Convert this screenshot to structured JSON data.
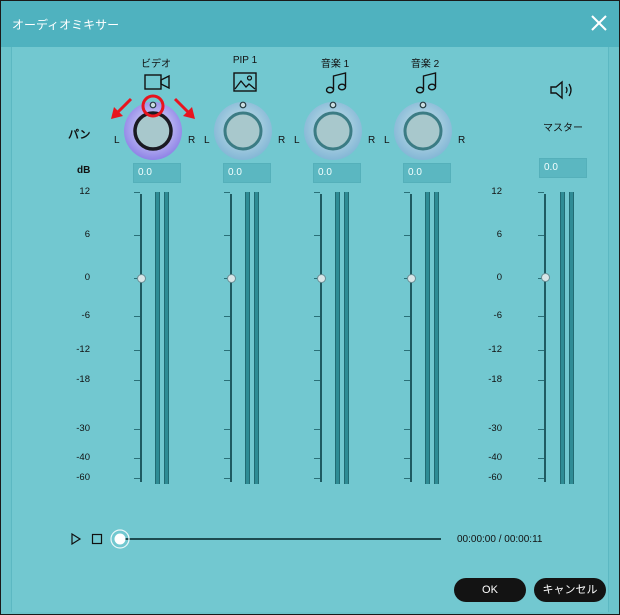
{
  "window": {
    "title": "オーディオミキサー"
  },
  "pan_label": "パン",
  "db_label": "dB",
  "channels": [
    {
      "name": "ビデオ",
      "icon": "video-camera-icon",
      "value": "0.0",
      "pan_left": "L",
      "pan_right": "R"
    },
    {
      "name": "PIP 1",
      "icon": "image-icon",
      "value": "0.0",
      "pan_left": "L",
      "pan_right": "R"
    },
    {
      "name": "音楽 1",
      "icon": "music-note-icon",
      "value": "0.0",
      "pan_left": "L",
      "pan_right": "R"
    },
    {
      "name": "音楽 2",
      "icon": "music-note-icon",
      "value": "0.0",
      "pan_left": "L",
      "pan_right": "R"
    }
  ],
  "master": {
    "name": "マスター",
    "icon": "speaker-icon",
    "value": "0.0"
  },
  "scale_ticks": [
    "12",
    "6",
    "0",
    "-6",
    "-12",
    "-18",
    "-30",
    "-40",
    "-60"
  ],
  "playback": {
    "time": "00:00:00 / 00:00:11",
    "progress": 0
  },
  "buttons": {
    "ok": "OK",
    "cancel": "キャンセル"
  },
  "colors": {
    "titlebar": "#4fb2bf",
    "panel": "#72c8d0",
    "annotation": "#e8141e"
  }
}
